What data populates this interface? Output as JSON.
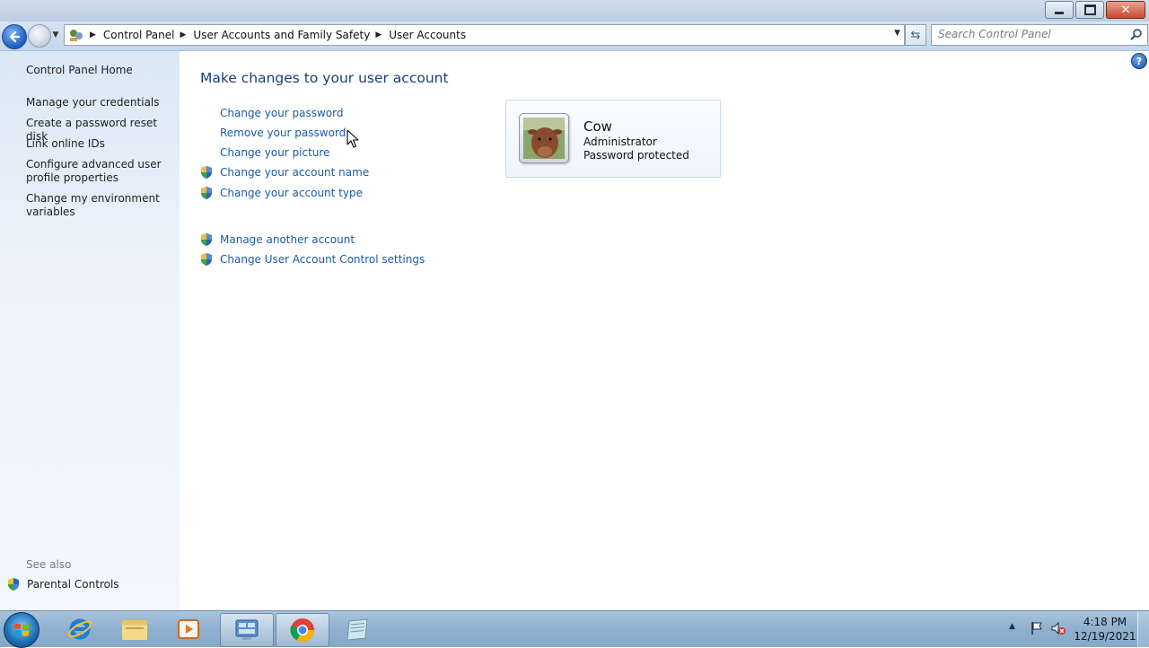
{
  "window": {
    "minimize_label": "–",
    "restore_label": "❐",
    "close_label": "✕"
  },
  "address": {
    "breadcrumbs": [
      "Control Panel",
      "User Accounts and Family Safety",
      "User Accounts"
    ],
    "search_placeholder": "Search Control Panel"
  },
  "sidebar": {
    "home": "Control Panel Home",
    "items": [
      {
        "label": "Manage your credentials"
      },
      {
        "label": "Create a password reset disk"
      },
      {
        "label": "Link online IDs"
      },
      {
        "label": "Configure advanced user profile properties"
      },
      {
        "label": "Change my environment variables"
      }
    ],
    "see_also_heading": "See also",
    "see_also_items": [
      {
        "label": "Parental Controls",
        "icon": "shield-icon"
      }
    ]
  },
  "main": {
    "title": "Make changes to your user account",
    "tasks": [
      {
        "label": "Change your password",
        "icon": null
      },
      {
        "label": "Remove your password",
        "icon": null
      },
      {
        "label": "Change your picture",
        "icon": null
      },
      {
        "label": "Change your account name",
        "icon": "shield-icon"
      },
      {
        "label": "Change your account type",
        "icon": "shield-icon"
      }
    ],
    "other_tasks": [
      {
        "label": "Manage another account",
        "icon": "shield-icon"
      },
      {
        "label": "Change User Account Control settings",
        "icon": "shield-icon"
      }
    ],
    "help_label": "?"
  },
  "account": {
    "name": "Cow",
    "type": "Administrator",
    "status": "Password protected"
  },
  "taskbar": {
    "apps": [
      "internet-explorer",
      "windows-explorer",
      "media-player",
      "control-panel",
      "chrome",
      "notepad"
    ],
    "active_app": "chrome",
    "time": "4:18 PM",
    "date": "12/19/2021"
  },
  "colors": {
    "link": "#1a5ba6",
    "title": "#1b3e79",
    "sidebar_bg": "#dbe8f6",
    "taskbar_bg": "#8fb0cf"
  }
}
